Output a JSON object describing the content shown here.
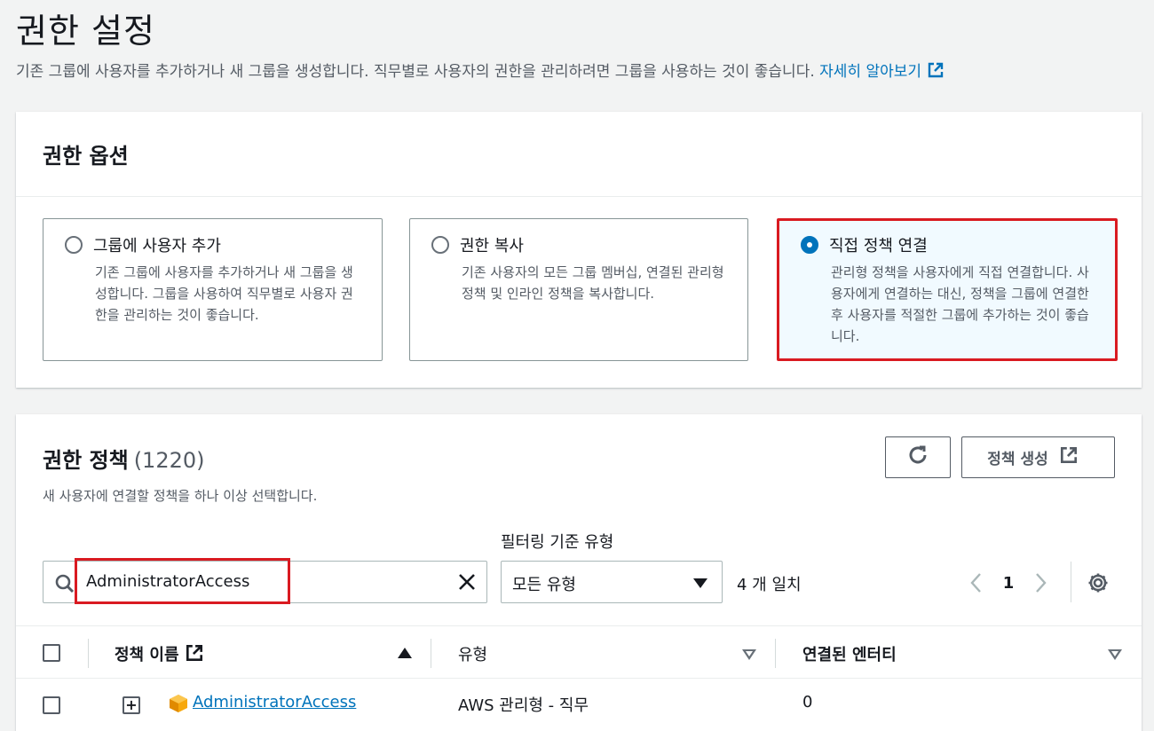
{
  "header": {
    "title": "권한 설정",
    "description": "기존 그룹에 사용자를 추가하거나 새 그룹을 생성합니다. 직무별로 사용자의 권한을 관리하려면 그룹을 사용하는 것이 좋습니다.",
    "learn_more": "자세히 알아보기"
  },
  "options": {
    "title": "권한 옵션",
    "cards": [
      {
        "title": "그룹에 사용자 추가",
        "desc": "기존 그룹에 사용자를 추가하거나 새 그룹을 생성합니다. 그룹을 사용하여 직무별로 사용자 권한을 관리하는 것이 좋습니다.",
        "selected": false
      },
      {
        "title": "권한 복사",
        "desc": "기존 사용자의 모든 그룹 멤버십, 연결된 관리형 정책 및 인라인 정책을 복사합니다.",
        "selected": false
      },
      {
        "title": "직접 정책 연결",
        "desc": "관리형 정책을 사용자에게 직접 연결합니다. 사용자에게 연결하는 대신, 정책을 그룹에 연결한 후 사용자를 적절한 그룹에 추가하는 것이 좋습니다.",
        "selected": true
      }
    ]
  },
  "policies": {
    "title": "권한 정책",
    "count": "(1220)",
    "subtitle": "새 사용자에 연결할 정책을 하나 이상 선택합니다.",
    "create_button": "정책 생성",
    "filter_label": "필터링 기준 유형",
    "search_value": "AdministratorAccess",
    "filter_type_value": "모든 유형",
    "match_count": "4 개 일치",
    "page": "1",
    "columns": {
      "name": "정책 이름",
      "type": "유형",
      "entities": "연결된 엔터티"
    },
    "rows": [
      {
        "name": "AdministratorAccess",
        "type": "AWS 관리형 - 직무",
        "entities": "0"
      }
    ]
  },
  "colors": {
    "accent": "#0073bb",
    "highlight": "#d91a21"
  }
}
